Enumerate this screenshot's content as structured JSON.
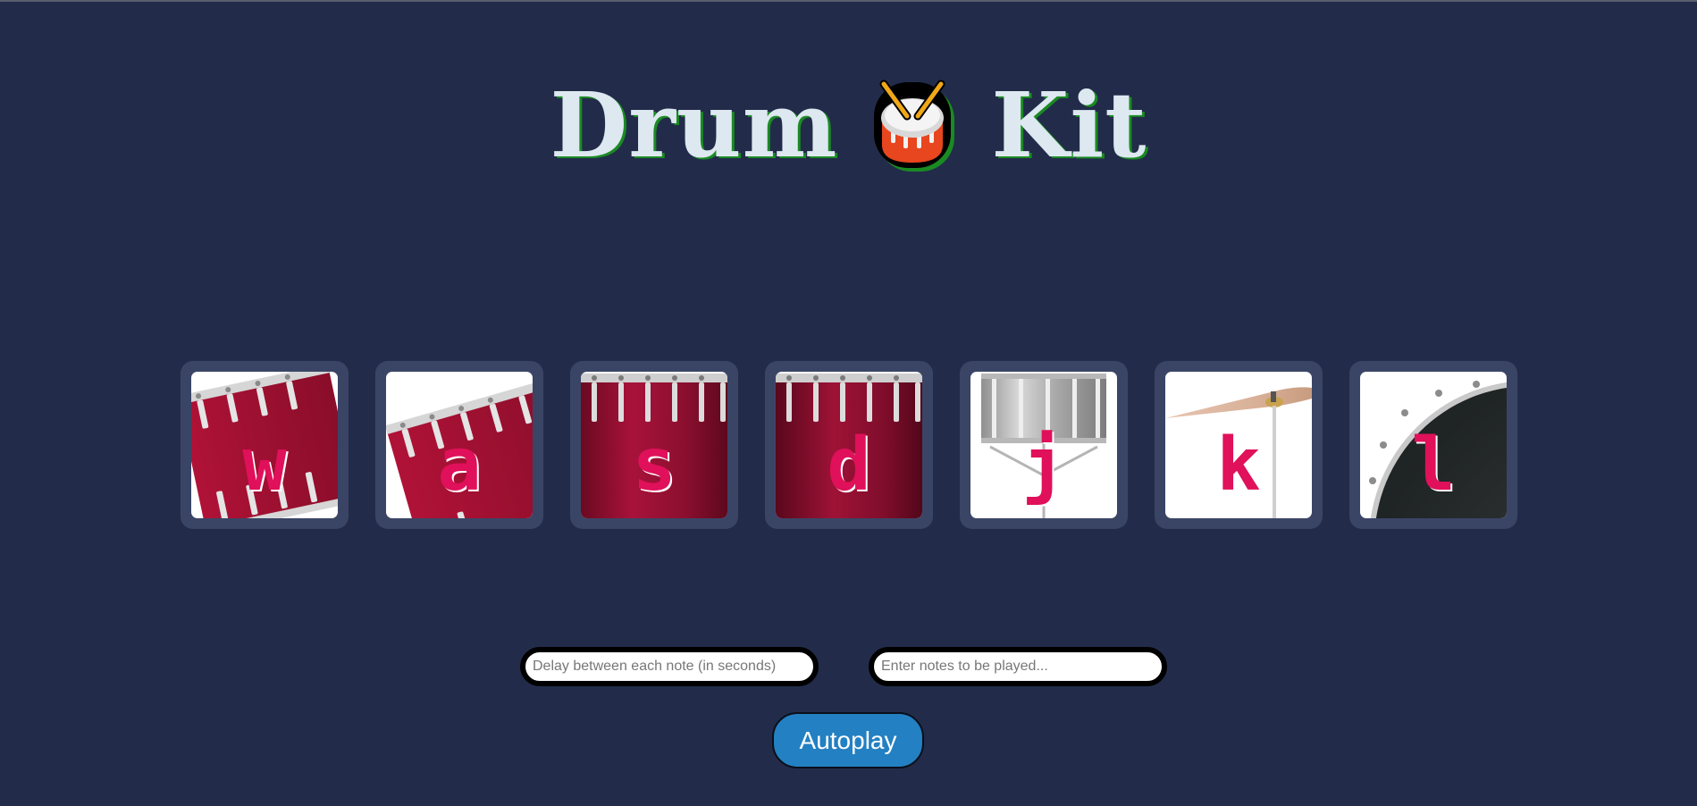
{
  "page": {
    "title_left": "Drum",
    "title_right": "Kit",
    "title_icon": "drum-emoji-icon"
  },
  "pads": [
    {
      "key": "w",
      "image": "tom-1-drum",
      "label": "w"
    },
    {
      "key": "a",
      "image": "tom-2-drum",
      "label": "a"
    },
    {
      "key": "s",
      "image": "tom-3-drum",
      "label": "s"
    },
    {
      "key": "d",
      "image": "tom-4-drum",
      "label": "d"
    },
    {
      "key": "j",
      "image": "snare-drum",
      "label": "j"
    },
    {
      "key": "k",
      "image": "crash-cymbal",
      "label": "k"
    },
    {
      "key": "l",
      "image": "kick-drum",
      "label": "l"
    }
  ],
  "controls": {
    "delay_placeholder": "Delay between each note (in seconds)",
    "delay_value": "",
    "notes_placeholder": "Enter notes to be played...",
    "notes_value": "",
    "autoplay_label": "Autoplay"
  },
  "colors": {
    "background": "#222c4a",
    "pad_frame": "#3a4566",
    "letter": "#e0105a",
    "title_text": "#dde8f0",
    "title_shadow": "#1a8a23",
    "button": "#2380c2"
  }
}
